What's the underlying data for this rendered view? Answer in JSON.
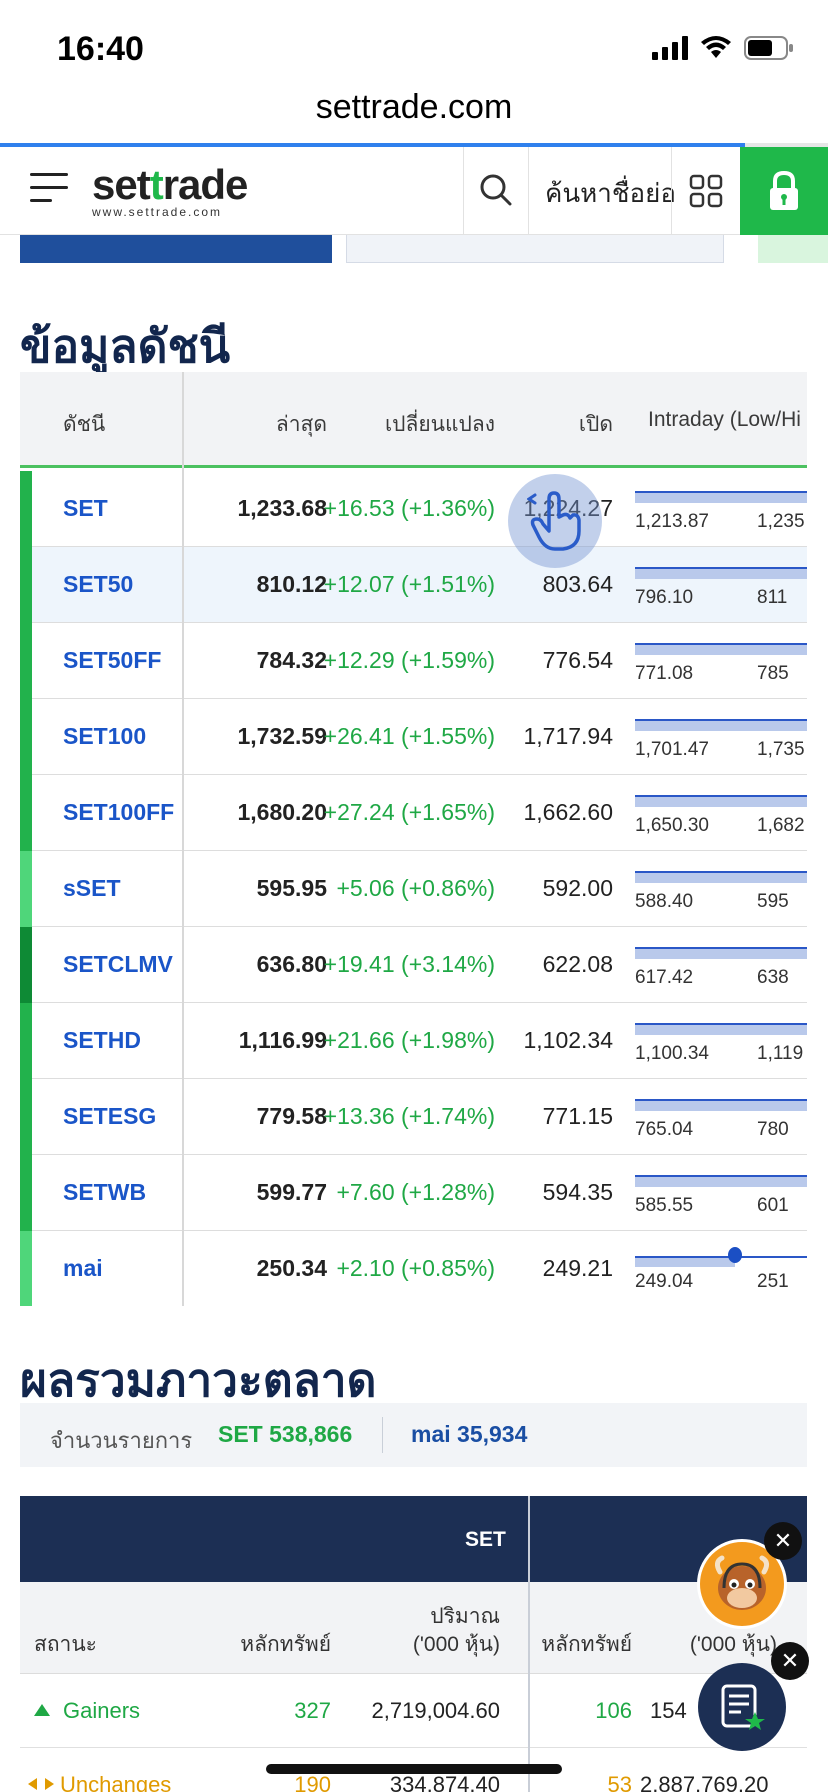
{
  "status": {
    "time": "16:40"
  },
  "browser": {
    "url": "settrade.com",
    "load_progress": 0.9
  },
  "header": {
    "logo_main_a": "set",
    "logo_main_t": "t",
    "logo_main_b": "rade",
    "logo_sub": "www.settrade.com",
    "search_label": "ค้นหาชื่อย่อ",
    "icons": [
      "menu-icon",
      "search-icon",
      "grid-icon",
      "lock-icon"
    ],
    "accent": "#1fb84a"
  },
  "index_section": {
    "title": "ข้อมูลดัชนี",
    "headers": {
      "name": "ดัชนี",
      "last": "ล่าสุด",
      "change": "เปลี่ยนแปลง",
      "open": "เปิด",
      "intraday": "Intraday (Low/Hi"
    },
    "rows": [
      {
        "name": "SET",
        "last": "1,233.68",
        "change": "+16.53 (+1.36%)",
        "open": "1,224.27",
        "low": "1,213.87",
        "high": "1,235",
        "bar_color": "#22b24c"
      },
      {
        "name": "SET50",
        "last": "810.12",
        "change": "+12.07 (+1.51%)",
        "open": "803.64",
        "low": "796.10",
        "high": "811",
        "bar_color": "#22b24c"
      },
      {
        "name": "SET50FF",
        "last": "784.32",
        "change": "+12.29 (+1.59%)",
        "open": "776.54",
        "low": "771.08",
        "high": "785",
        "bar_color": "#22b24c"
      },
      {
        "name": "SET100",
        "last": "1,732.59",
        "change": "+26.41 (+1.55%)",
        "open": "1,717.94",
        "low": "1,701.47",
        "high": "1,735",
        "bar_color": "#22b24c"
      },
      {
        "name": "SET100FF",
        "last": "1,680.20",
        "change": "+27.24 (+1.65%)",
        "open": "1,662.60",
        "low": "1,650.30",
        "high": "1,682",
        "bar_color": "#22b24c"
      },
      {
        "name": "sSET",
        "last": "595.95",
        "change": "+5.06 (+0.86%)",
        "open": "592.00",
        "low": "588.40",
        "high": "595",
        "bar_color": "#4fd67a"
      },
      {
        "name": "SETCLMV",
        "last": "636.80",
        "change": "+19.41 (+3.14%)",
        "open": "622.08",
        "low": "617.42",
        "high": "638",
        "bar_color": "#0e8a35"
      },
      {
        "name": "SETHD",
        "last": "1,116.99",
        "change": "+21.66 (+1.98%)",
        "open": "1,102.34",
        "low": "1,100.34",
        "high": "1,119",
        "bar_color": "#22b24c"
      },
      {
        "name": "SETESG",
        "last": "779.58",
        "change": "+13.36 (+1.74%)",
        "open": "771.15",
        "low": "765.04",
        "high": "780",
        "bar_color": "#22b24c"
      },
      {
        "name": "SETWB",
        "last": "599.77",
        "change": "+7.60 (+1.28%)",
        "open": "594.35",
        "low": "585.55",
        "high": "601",
        "bar_color": "#22b24c"
      },
      {
        "name": "mai",
        "last": "250.34",
        "change": "+2.10 (+0.85%)",
        "open": "249.21",
        "low": "249.04",
        "high": "251",
        "bar_color": "#4fd67a"
      }
    ]
  },
  "market_section": {
    "title": "ผลรวมภาวะตลาด",
    "summary_label": "จำนวนรายการ",
    "summary_set": "SET 538,866",
    "summary_mai": "mai 35,934",
    "group_set": "SET",
    "headers": {
      "status": "สถานะ",
      "securities": "หลักทรัพย์",
      "volume_1": "ปริมาณ",
      "volume_2": "('000 หุ้น)",
      "securities_b": "หลักทรัพย์",
      "volume_b": "('000 หุ้น)"
    },
    "rows": [
      {
        "status": "Gainers",
        "set_count": "327",
        "set_volume": "2,719,004.60",
        "mai_count": "106",
        "mai_volume": "154"
      },
      {
        "status": "Unchanges",
        "set_count": "190",
        "set_volume": "334,874.40",
        "mai_count": "53",
        "mai_volume": "2,887,769.20"
      }
    ]
  }
}
